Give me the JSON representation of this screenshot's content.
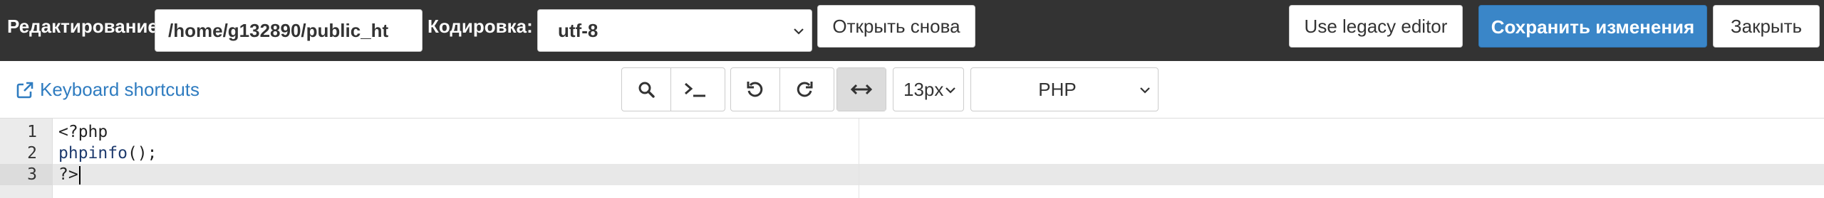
{
  "header": {
    "edit_label": "Редактирование:",
    "path_value": "/home/g132890/public_ht",
    "encoding_label": "Кодировка:",
    "encoding_value": "utf-8",
    "reopen_label": "Открыть снова",
    "legacy_label": "Use legacy editor",
    "save_label": "Сохранить изменения",
    "close_label": "Закрыть",
    "save_color": "#3a86c8"
  },
  "toolbar": {
    "shortcuts_label": "Keyboard shortcuts",
    "font_size": "13px",
    "language": "PHP",
    "link_color": "#2f7cc0",
    "icons": [
      "search-icon",
      "terminal-icon",
      "undo-icon",
      "redo-icon",
      "wrap-icon"
    ]
  },
  "editor": {
    "lines": [
      {
        "number": "1",
        "text": "<?php"
      },
      {
        "number": "2",
        "fn": "phpinfo",
        "rest": "();"
      },
      {
        "number": "3",
        "text": "?>"
      }
    ]
  }
}
